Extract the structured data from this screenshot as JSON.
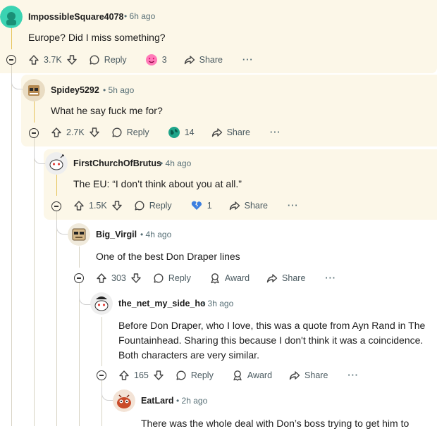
{
  "comments": [
    {
      "user": "ImpossibleSquare4078",
      "time": "6h ago",
      "body": [
        "Europe? Did I miss something?"
      ],
      "score": "3.7K",
      "reply": "Reply",
      "award_count": "3",
      "award_label": "",
      "share": "Share",
      "more": "···"
    },
    {
      "user": "Spidey5292",
      "time": "5h ago",
      "body": [
        "What he say fuck me for?"
      ],
      "score": "2.7K",
      "reply": "Reply",
      "award_count": "14",
      "award_label": "",
      "share": "Share",
      "more": "···"
    },
    {
      "user": "FirstChurchOfBrutus",
      "time": "4h ago",
      "body": [
        "The EU: “I don’t think about you at all.”"
      ],
      "score": "1.5K",
      "reply": "Reply",
      "award_count": "1",
      "award_label": "",
      "share": "Share",
      "more": "···"
    },
    {
      "user": "Big_Virgil",
      "time": "4h ago",
      "body": [
        "One of the best Don Draper lines"
      ],
      "score": "303",
      "reply": "Reply",
      "award_count": "",
      "award_label": "Award",
      "share": "Share",
      "more": "···"
    },
    {
      "user": "the_net_my_side_ho",
      "time": "3h ago",
      "body": [
        "Before Don Draper, who I love, this was a quote from Ayn Rand in The",
        "Fountainhead. Sharing this because I don't think it was a coincidence.",
        "Both characters are very similar."
      ],
      "score": "165",
      "reply": "Reply",
      "award_count": "",
      "award_label": "Award",
      "share": "Share",
      "more": "···"
    },
    {
      "user": "EatLard",
      "time": "2h ago",
      "body": [
        "There was the whole deal with Don’s boss trying to get him to"
      ],
      "score": "",
      "reply": "",
      "award_count": "",
      "award_label": "",
      "share": "",
      "more": ""
    }
  ],
  "separator": "•",
  "colors": {
    "highlight": "#fcf7e8",
    "thread_line": "#e6c35a",
    "meta": "#576f76",
    "text": "#1c1c1c"
  },
  "icons": {
    "upvote": "upvote-arrow-icon",
    "downvote": "downvote-arrow-icon",
    "reply": "speech-bubble-icon",
    "share": "share-arrow-icon",
    "award": "award-ribbon-icon",
    "collapse": "collapse-minus-icon"
  }
}
